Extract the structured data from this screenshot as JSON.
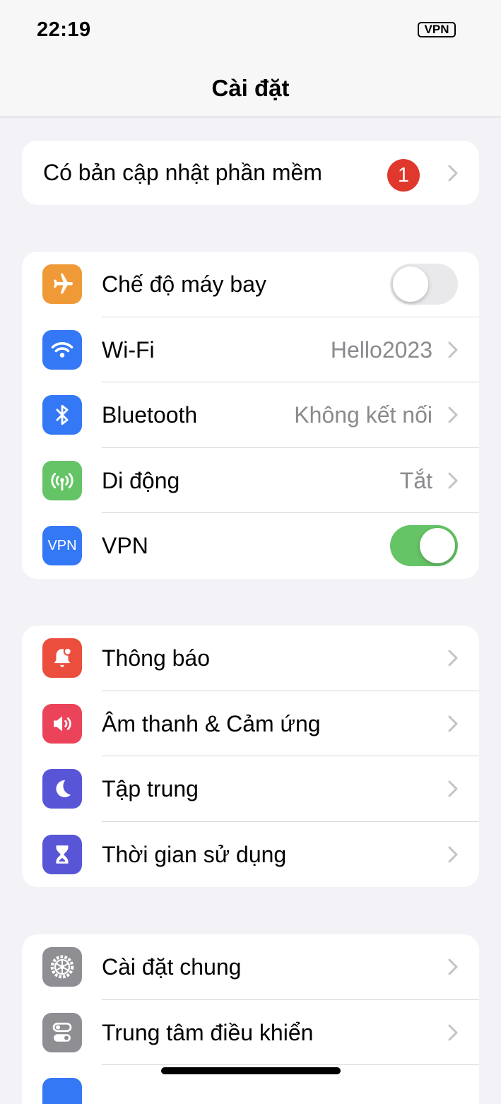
{
  "status_bar": {
    "time": "22:19",
    "vpn_label": "VPN"
  },
  "nav": {
    "title": "Cài đặt"
  },
  "update_row": {
    "label": "Có bản cập nhật phần mềm",
    "badge_count": "1"
  },
  "connectivity": [
    {
      "label": "Chế độ máy bay",
      "icon": "airplane-icon",
      "icon_color": "#f09a37",
      "toggle": "off"
    },
    {
      "label": "Wi-Fi",
      "icon": "wifi-icon",
      "icon_color": "#3478f6",
      "value": "Hello2023"
    },
    {
      "label": "Bluetooth",
      "icon": "bluetooth-icon",
      "icon_color": "#3478f6",
      "value": "Không kết nối"
    },
    {
      "label": "Di động",
      "icon": "cellular-icon",
      "icon_color": "#65c466",
      "value": "Tắt"
    },
    {
      "label": "VPN",
      "icon": "vpn-icon",
      "icon_text": "VPN",
      "icon_color": "#3478f6",
      "toggle": "on"
    }
  ],
  "notifications": [
    {
      "label": "Thông báo",
      "icon": "bell-icon",
      "icon_color": "#eb4e3d"
    },
    {
      "label": "Âm thanh & Cảm ứng",
      "icon": "speaker-icon",
      "icon_color": "#eb445a"
    },
    {
      "label": "Tập trung",
      "icon": "moon-icon",
      "icon_color": "#5856d6"
    },
    {
      "label": "Thời gian sử dụng",
      "icon": "hourglass-icon",
      "icon_color": "#5856d6"
    }
  ],
  "general": [
    {
      "label": "Cài đặt chung",
      "icon": "gear-icon",
      "icon_color": "#8e8e93"
    },
    {
      "label": "Trung tâm điều khiển",
      "icon": "control-center-icon",
      "icon_color": "#8e8e93"
    }
  ]
}
